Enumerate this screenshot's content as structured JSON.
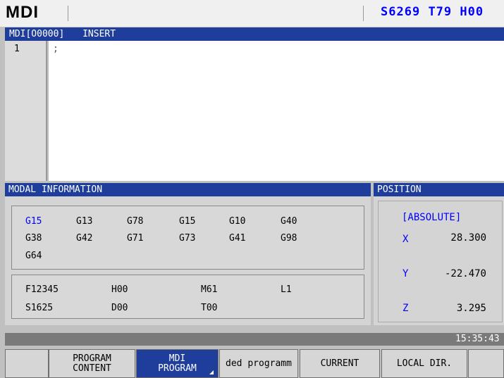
{
  "header": {
    "mode": "MDI",
    "spindle_status": "S6269",
    "tool_status": "T79",
    "h_status": "H00"
  },
  "editor": {
    "title": "MDI[O0000]",
    "edit_mode": "INSERT",
    "line_number": "1",
    "content": ";"
  },
  "modal": {
    "title": "MODAL INFORMATION",
    "gcodes": [
      "G15",
      "G13",
      "G78",
      "G15",
      "G10",
      "G40",
      "G38",
      "G42",
      "G71",
      "G73",
      "G41",
      "G98",
      "G64"
    ],
    "values": {
      "F": "F12345",
      "H": "H00",
      "M": "M61",
      "L": "L1",
      "S": "S1625",
      "D": "D00",
      "T": "T00"
    }
  },
  "position": {
    "title": "POSITION",
    "mode": "[ABSOLUTE]",
    "axes": [
      {
        "label": "X",
        "value": "28.300"
      },
      {
        "label": "Y",
        "value": "-22.470"
      },
      {
        "label": "Z",
        "value": "3.295"
      }
    ]
  },
  "status": {
    "time": "15:35:43"
  },
  "softkeys": [
    {
      "label": ""
    },
    {
      "label": "PROGRAM\nCONTENT"
    },
    {
      "label": "MDI\nPROGRAM"
    },
    {
      "label": "ded programm"
    },
    {
      "label": "CURRENT"
    },
    {
      "label": "LOCAL DIR."
    },
    {
      "label": ""
    }
  ],
  "colors": {
    "accent_blue": "#1f3e9c",
    "highlight_red": "#ff0000",
    "label_blue": "#0000ff"
  }
}
